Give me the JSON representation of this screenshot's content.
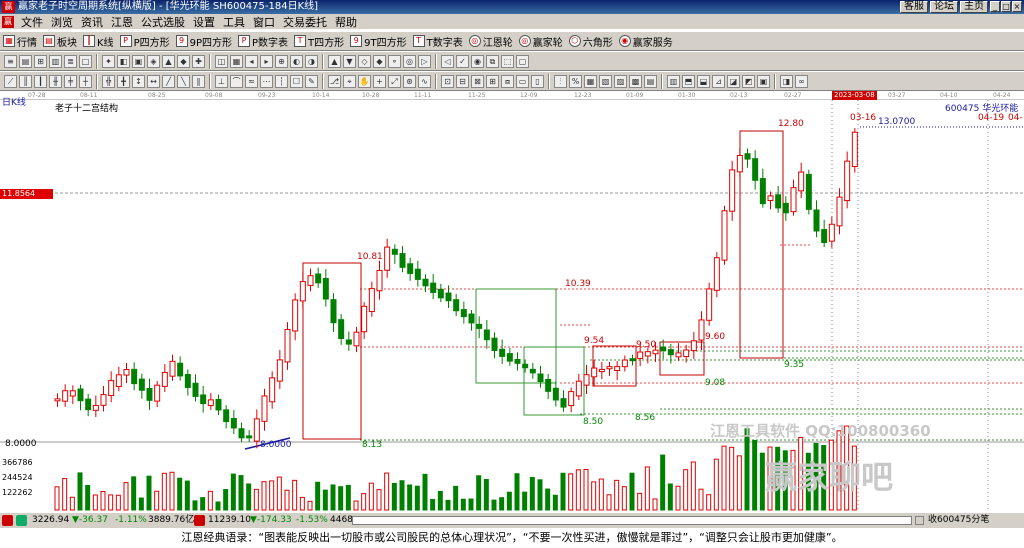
{
  "window": {
    "title": "赢家老子时空周期系统[纵横版] - [华光环能  SH600475-184日K线]",
    "title_buttons": [
      "客服",
      "论坛",
      "主页"
    ],
    "window_buttons": [
      "_",
      "□",
      "×"
    ]
  },
  "menu": [
    "文件",
    "浏览",
    "资讯",
    "江恩",
    "公式选股",
    "设置",
    "工具",
    "窗口",
    "交易委托",
    "帮助"
  ],
  "toolbar1": [
    "行情",
    "板块",
    "K线",
    "P四方形",
    "9P四方形",
    "P数字表",
    "T四方形",
    "9T四方形",
    "T数字表",
    "江恩轮",
    "赢家轮",
    "六角形",
    "赢家服务"
  ],
  "date_axis": [
    "07-28",
    "08-11",
    "08-25",
    "09-08",
    "09-23",
    "10-14",
    "10-28",
    "11-11",
    "11-25",
    "12-09",
    "12-23",
    "01-09",
    "01-30",
    "02-13",
    "02-27",
    "2023-03-08",
    "03-27",
    "04-10",
    "04-24"
  ],
  "chart_header": {
    "period": "日K线",
    "indicator": "老子十二宫结构",
    "stock": "600475  华光环能",
    "price_tag": "11.8564",
    "low_axis": "8.0000"
  },
  "price_labels": {
    "p1081": "10.81",
    "p1039": "10.39",
    "p954": "9.54",
    "p950": "9.50",
    "p960": "9.60",
    "p1280": "12.80",
    "p935": "9.35",
    "p908": "9.08",
    "p850": "8.50",
    "p856": "8.56",
    "p813": "8.13",
    "p800": "8.0000",
    "p1307": "13.0700",
    "d0316": "03-16",
    "d0419": "04-19",
    "d04x": "04-"
  },
  "volume_axis": [
    "366786",
    "244524",
    "122262"
  ],
  "watermark": [
    "江恩工具软件  QQ:100800360",
    "赢家聊吧"
  ],
  "status": {
    "sh_index": "3226.94",
    "sh_change": "▼-36.37",
    "sh_pct": "-1.11%",
    "sh_amount": "3889.76亿",
    "sz_index": "11239.10",
    "sz_change": "▼-174.33",
    "sz_pct": "-1.53%",
    "sz_amount": "4468",
    "right": "收600475分笔"
  },
  "quote": "江恩经典语录：“图表能反映出一切股市或公司股民的总体心理状况”，“不要一次性买进，傲慢就是罪过”，“调整只会让股市更加健康”。",
  "colors": {
    "up": "#e00000",
    "down": "#008000",
    "box": "#c00000",
    "accent": "#0a246a"
  }
}
